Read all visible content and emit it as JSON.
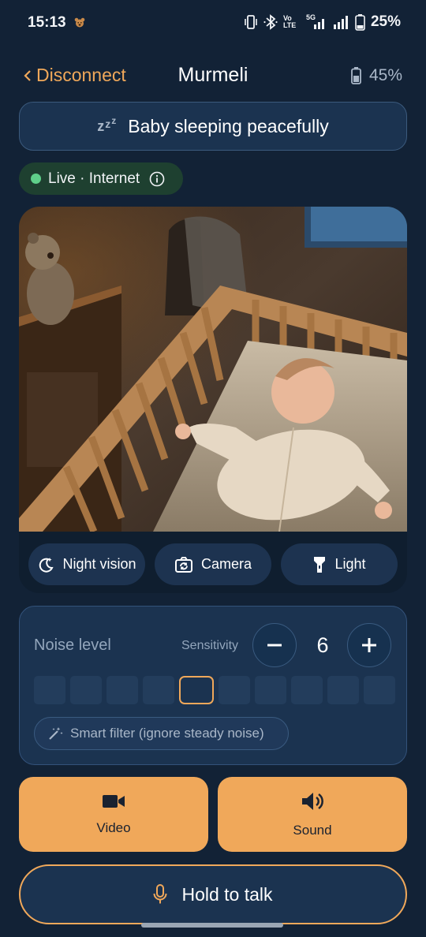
{
  "status_bar": {
    "time": "15:13",
    "battery_pct": "25%",
    "network_5g": "5G",
    "volte": "Vo LTE",
    "icons": [
      "bear-notification-icon",
      "vibrate-icon",
      "bluetooth-icon",
      "volte-icon",
      "signal-5g-icon",
      "signal-icon",
      "battery-icon"
    ]
  },
  "header": {
    "back_label": "Disconnect",
    "title": "Murmeli",
    "battery_label": "45%",
    "battery_level": 0.45
  },
  "banner": {
    "icon": "zzz",
    "text": "Baby sleeping peacefully"
  },
  "connection": {
    "text": "Live · Internet",
    "status_color": "#5fd08a"
  },
  "camera": {
    "controls": [
      {
        "label": "Night vision",
        "icon": "moon-stars-icon"
      },
      {
        "label": "Camera",
        "icon": "camera-switch-icon"
      },
      {
        "label": "Light",
        "icon": "flashlight-icon"
      }
    ]
  },
  "noise": {
    "title": "Noise level",
    "sensitivity_label": "Sensitivity",
    "sensitivity_value": "6",
    "bar_count": 10,
    "highlighted_bar_index": 4,
    "filter_label": "Smart filter (ignore steady noise)"
  },
  "actions": {
    "video_label": "Video",
    "sound_label": "Sound"
  },
  "talk": {
    "label": "Hold to talk"
  },
  "colors": {
    "background": "#122236",
    "accent": "#f0a85a",
    "card": "#1b3350",
    "live": "#1e4030"
  }
}
